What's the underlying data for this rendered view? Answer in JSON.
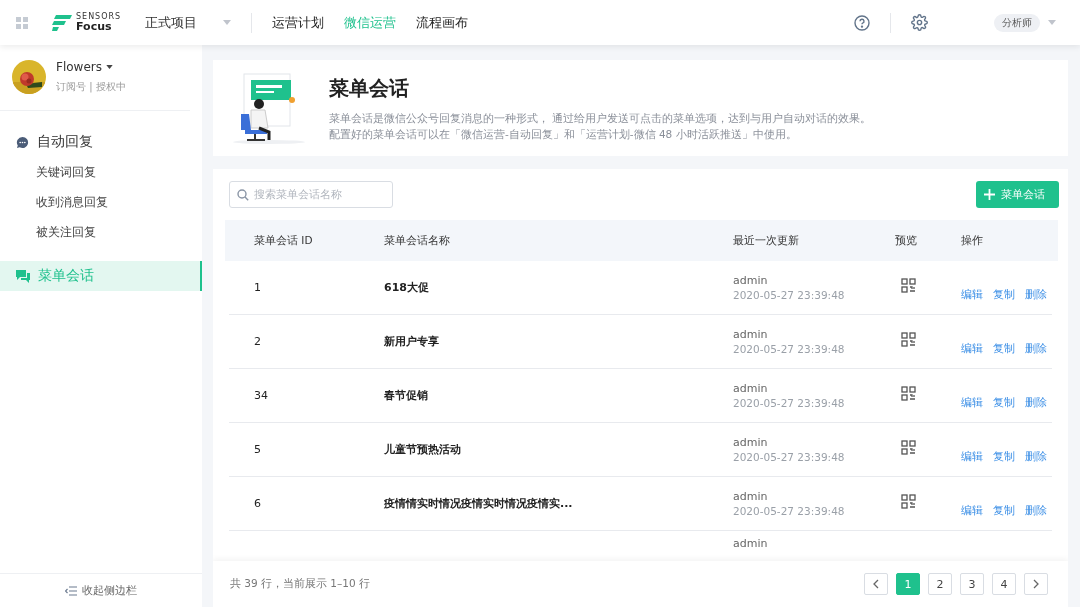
{
  "topbar": {
    "logo_small": "SENSORS",
    "logo_big": "Focus",
    "project": "正式项目",
    "nav": [
      {
        "label": "运营计划",
        "selected": false
      },
      {
        "label": "微信运营",
        "selected": true
      },
      {
        "label": "流程画布",
        "selected": false
      }
    ],
    "role": "分析师"
  },
  "sidebar": {
    "account": {
      "name": "Flowers",
      "meta": "订阅号 | 授权中"
    },
    "groups": [
      {
        "label": "自动回复",
        "kind": "group",
        "selected": false,
        "children": [
          {
            "label": "关键词回复",
            "selected": false
          },
          {
            "label": "收到消息回复",
            "selected": false
          },
          {
            "label": "被关注回复",
            "selected": false
          }
        ]
      },
      {
        "label": "菜单会话",
        "kind": "page",
        "selected": true
      }
    ],
    "collapse": "收起侧边栏"
  },
  "header": {
    "title": "菜单会话",
    "lines": [
      "菜单会话是微信公众号回复消息的一种形式， 通过给用户发送可点击的菜单选项，达到与用户自动对话的效果。",
      "配置好的菜单会话可以在「微信运营-自动回复」和「运营计划-微信 48 小时活跃推送」中使用。"
    ]
  },
  "toolbar": {
    "search": {
      "placeholder": "搜索菜单会话名称"
    },
    "add_button": "菜单会话"
  },
  "table": {
    "columns": [
      "菜单会话 ID",
      "菜单会话名称",
      "最近一次更新",
      "预览",
      "操作"
    ],
    "rows": [
      {
        "id": "1",
        "name": "618大促",
        "user": "admin",
        "time": "2020-05-27 23:39:48",
        "actions": [
          "编辑",
          "复制",
          "删除"
        ]
      },
      {
        "id": "2",
        "name": "新用户专享",
        "user": "admin",
        "time": "2020-05-27 23:39:48",
        "actions": [
          "编辑",
          "复制",
          "删除"
        ]
      },
      {
        "id": "34",
        "name": "春节促销",
        "user": "admin",
        "time": "2020-05-27 23:39:48",
        "actions": [
          "编辑",
          "复制",
          "删除"
        ]
      },
      {
        "id": "5",
        "name": "儿童节预热活动",
        "user": "admin",
        "time": "2020-05-27 23:39:48",
        "actions": [
          "编辑",
          "复制",
          "删除"
        ]
      },
      {
        "id": "6",
        "name": "疫情情实时情况疫情实时情况疫情实...",
        "user": "admin",
        "time": "2020-05-27 23:39:48",
        "actions": [
          "编辑",
          "复制",
          "删除"
        ]
      }
    ],
    "partial_row": {
      "user": "admin"
    }
  },
  "footer": {
    "summary": "共 39 行，当前展示 1–10 行",
    "pages": [
      {
        "label": "1",
        "selected": true
      },
      {
        "label": "2",
        "selected": false
      },
      {
        "label": "3",
        "selected": false
      },
      {
        "label": "4",
        "selected": false
      }
    ]
  }
}
